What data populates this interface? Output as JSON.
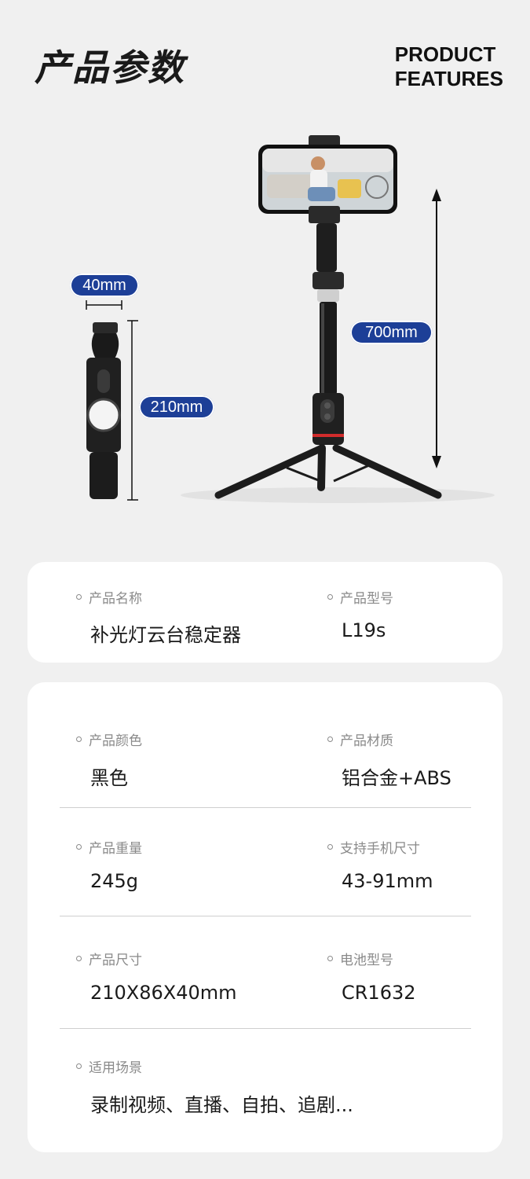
{
  "header": {
    "title_cn": "产品参数",
    "title_en_line1": "PRODUCT",
    "title_en_line2": "FEATURES"
  },
  "figure": {
    "width_label": "40mm",
    "height_small_label": "210mm",
    "height_large_label": "700mm",
    "accent_color": "#1d3f97"
  },
  "card1": {
    "items": [
      {
        "label": "产品名称",
        "value": "补光灯云台稳定器"
      },
      {
        "label": "产品型号",
        "value": "L19s"
      }
    ]
  },
  "card2": {
    "items": [
      {
        "label": "产品颜色",
        "value": "黑色"
      },
      {
        "label": "产品材质",
        "value": "铝合金+ABS"
      },
      {
        "label": "产品重量",
        "value": "245g"
      },
      {
        "label": "支持手机尺寸",
        "value": "43-91mm"
      },
      {
        "label": "产品尺寸",
        "value": "210X86X40mm"
      },
      {
        "label": "电池型号",
        "value": "CR1632"
      },
      {
        "label": "适用场景",
        "value": "录制视频、直播、自拍、追剧..."
      }
    ]
  }
}
